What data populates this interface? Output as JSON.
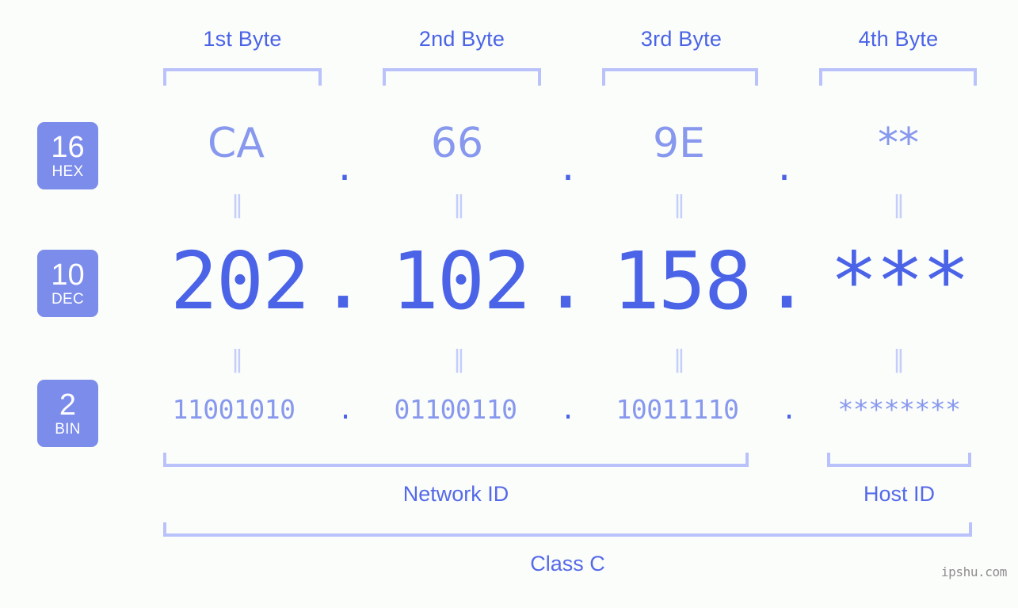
{
  "meta": {
    "watermark": "ipshu.com",
    "colors": {
      "background": "#fbfdfa",
      "badge_fill": "#7b8ceb",
      "badge_text": "#ffffff",
      "accent_strong": "#4a63e7",
      "accent_light": "#8798ee",
      "bracket": "#b9c2fb",
      "equals": "#c5cdfb",
      "watermark": "#8e8e8e"
    }
  },
  "header": {
    "byte_labels": [
      "1st Byte",
      "2nd Byte",
      "3rd Byte",
      "4th Byte"
    ]
  },
  "rows": {
    "hex": {
      "badge_number": "16",
      "badge_unit": "HEX",
      "values": [
        "CA",
        "66",
        "9E",
        "**"
      ],
      "separators": [
        ".",
        ".",
        "."
      ]
    },
    "dec": {
      "badge_number": "10",
      "badge_unit": "DEC",
      "values": [
        "202",
        "102",
        "158",
        "***"
      ],
      "separators": [
        ".",
        ".",
        "."
      ]
    },
    "bin": {
      "badge_number": "2",
      "badge_unit": "BIN",
      "values": [
        "11001010",
        "01100110",
        "10011110",
        "********"
      ],
      "separators": [
        ".",
        ".",
        "."
      ]
    }
  },
  "connectors": {
    "equals_symbol": "‖"
  },
  "footer": {
    "network_id_label": "Network ID",
    "host_id_label": "Host ID",
    "class_label": "Class C"
  }
}
